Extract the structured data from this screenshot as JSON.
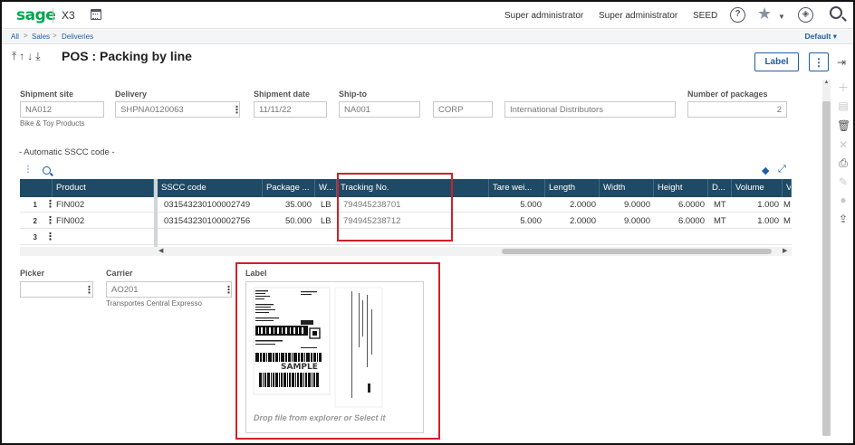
{
  "header": {
    "logo": "sage",
    "product": "X3",
    "user1": "Super administrator",
    "user2": "Super administrator",
    "folder": "SEED",
    "help": "?"
  },
  "breadcrumb": [
    "All",
    "Sales",
    "Deliveries"
  ],
  "dashboard_selector": "Default",
  "page": {
    "title": "POS : Packing by line",
    "label_button": "Label",
    "more_button": "⋮"
  },
  "fields": {
    "shipment_site": {
      "label": "Shipment site",
      "value": "NA012",
      "sub": "Bike & Toy Products"
    },
    "delivery": {
      "label": "Delivery",
      "value": "SHPNA0120063"
    },
    "shipment_date": {
      "label": "Shipment date",
      "value": "11/11/22"
    },
    "ship_to": {
      "label": "Ship-to",
      "value": "NA001",
      "value2": "CORP",
      "value3": "International Distributors"
    },
    "number_of_packages": {
      "label": "Number of packages",
      "value": "2"
    },
    "picker": {
      "label": "Picker",
      "value": ""
    },
    "carrier": {
      "label": "Carrier",
      "value": "AO201",
      "sub": "Transportes Central Expresso"
    },
    "label": {
      "label": "Label",
      "drop_text": "Drop file from explorer or Select it"
    }
  },
  "section_title": "- Automatic SSCC code -",
  "grid": {
    "columns": [
      "Product",
      "SSCC code",
      "Package ...",
      "W...",
      "Tracking No.",
      "Tare wei...",
      "Length",
      "Width",
      "Height",
      "D...",
      "Volume",
      "V"
    ],
    "rows": [
      {
        "num": "1",
        "product": "FIN002",
        "sscc": "031543230100002749",
        "package": "35.000",
        "w": "LB",
        "tracking": "794945238701",
        "tare": "5.000",
        "length": "2.0000",
        "width": "9.0000",
        "height": "6.0000",
        "d": "MT",
        "volume": "1.000",
        "v": "M"
      },
      {
        "num": "2",
        "product": "FIN002",
        "sscc": "031543230100002756",
        "package": "50.000",
        "w": "LB",
        "tracking": "794945238712",
        "tare": "5.000",
        "length": "2.0000",
        "width": "9.0000",
        "height": "6.0000",
        "d": "MT",
        "volume": "1.000",
        "v": "M"
      },
      {
        "num": "3",
        "product": "",
        "sscc": "",
        "package": "",
        "w": "",
        "tracking": "",
        "tare": "",
        "length": "",
        "width": "",
        "height": "",
        "d": "",
        "volume": "",
        "v": ""
      }
    ]
  },
  "label_preview": {
    "watermark": "SAMPLE"
  }
}
